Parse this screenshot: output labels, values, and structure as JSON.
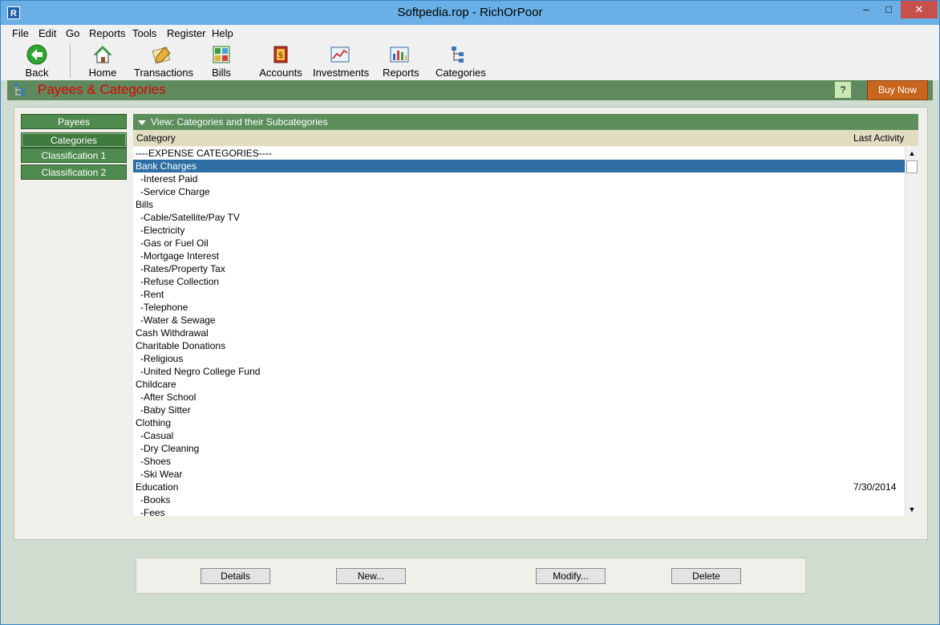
{
  "window": {
    "title": "Softpedia.rop - RichOrPoor",
    "app_icon_letter": "R",
    "controls": {
      "minimize": "–",
      "maximize": "□",
      "close": "✕"
    }
  },
  "menu": [
    "File",
    "Edit",
    "Go",
    "Reports",
    "Tools",
    "Register",
    "Help"
  ],
  "toolbar": {
    "back": "Back",
    "home": "Home",
    "transactions": "Transactions",
    "bills": "Bills",
    "accounts": "Accounts",
    "investments": "Investments",
    "reports": "Reports",
    "categories": "Categories"
  },
  "section": {
    "title": "Payees & Categories",
    "help_label": "?",
    "buy_label": "Buy Now"
  },
  "sidebar": {
    "items": [
      {
        "label": "Payees"
      },
      {
        "label": "Categories"
      },
      {
        "label": "Classification 1"
      },
      {
        "label": "Classification 2"
      }
    ],
    "active": "Categories"
  },
  "view": {
    "label": "View: Categories and their Subcategories"
  },
  "columns": {
    "category": "Category",
    "last_activity": "Last Activity"
  },
  "rows": [
    {
      "name": "----EXPENSE CATEGORIES----",
      "sub": false,
      "activity": ""
    },
    {
      "name": "Bank Charges",
      "sub": false,
      "activity": "",
      "selected": true
    },
    {
      "name": "-Interest Paid",
      "sub": true,
      "activity": ""
    },
    {
      "name": "-Service Charge",
      "sub": true,
      "activity": ""
    },
    {
      "name": "Bills",
      "sub": false,
      "activity": ""
    },
    {
      "name": "-Cable/Satellite/Pay TV",
      "sub": true,
      "activity": ""
    },
    {
      "name": "-Electricity",
      "sub": true,
      "activity": ""
    },
    {
      "name": "-Gas or Fuel Oil",
      "sub": true,
      "activity": ""
    },
    {
      "name": "-Mortgage Interest",
      "sub": true,
      "activity": ""
    },
    {
      "name": "-Rates/Property Tax",
      "sub": true,
      "activity": ""
    },
    {
      "name": "-Refuse Collection",
      "sub": true,
      "activity": ""
    },
    {
      "name": "-Rent",
      "sub": true,
      "activity": ""
    },
    {
      "name": "-Telephone",
      "sub": true,
      "activity": ""
    },
    {
      "name": "-Water & Sewage",
      "sub": true,
      "activity": ""
    },
    {
      "name": "Cash Withdrawal",
      "sub": false,
      "activity": ""
    },
    {
      "name": "Charitable Donations",
      "sub": false,
      "activity": ""
    },
    {
      "name": "-Religious",
      "sub": true,
      "activity": ""
    },
    {
      "name": "-United Negro College Fund",
      "sub": true,
      "activity": ""
    },
    {
      "name": "Childcare",
      "sub": false,
      "activity": ""
    },
    {
      "name": "-After School",
      "sub": true,
      "activity": ""
    },
    {
      "name": "-Baby Sitter",
      "sub": true,
      "activity": ""
    },
    {
      "name": "Clothing",
      "sub": false,
      "activity": ""
    },
    {
      "name": "-Casual",
      "sub": true,
      "activity": ""
    },
    {
      "name": "-Dry Cleaning",
      "sub": true,
      "activity": ""
    },
    {
      "name": "-Shoes",
      "sub": true,
      "activity": ""
    },
    {
      "name": "-Ski Wear",
      "sub": true,
      "activity": ""
    },
    {
      "name": "Education",
      "sub": false,
      "activity": "7/30/2014"
    },
    {
      "name": "-Books",
      "sub": true,
      "activity": ""
    },
    {
      "name": "-Fees",
      "sub": true,
      "activity": ""
    }
  ],
  "actions": {
    "details": "Details",
    "new": "New...",
    "modify": "Modify...",
    "delete": "Delete"
  },
  "colors": {
    "section_bar": "#5f8a5f",
    "section_title": "#e00000",
    "buy_button": "#c8651e",
    "selected_row": "#2f6ea5"
  }
}
